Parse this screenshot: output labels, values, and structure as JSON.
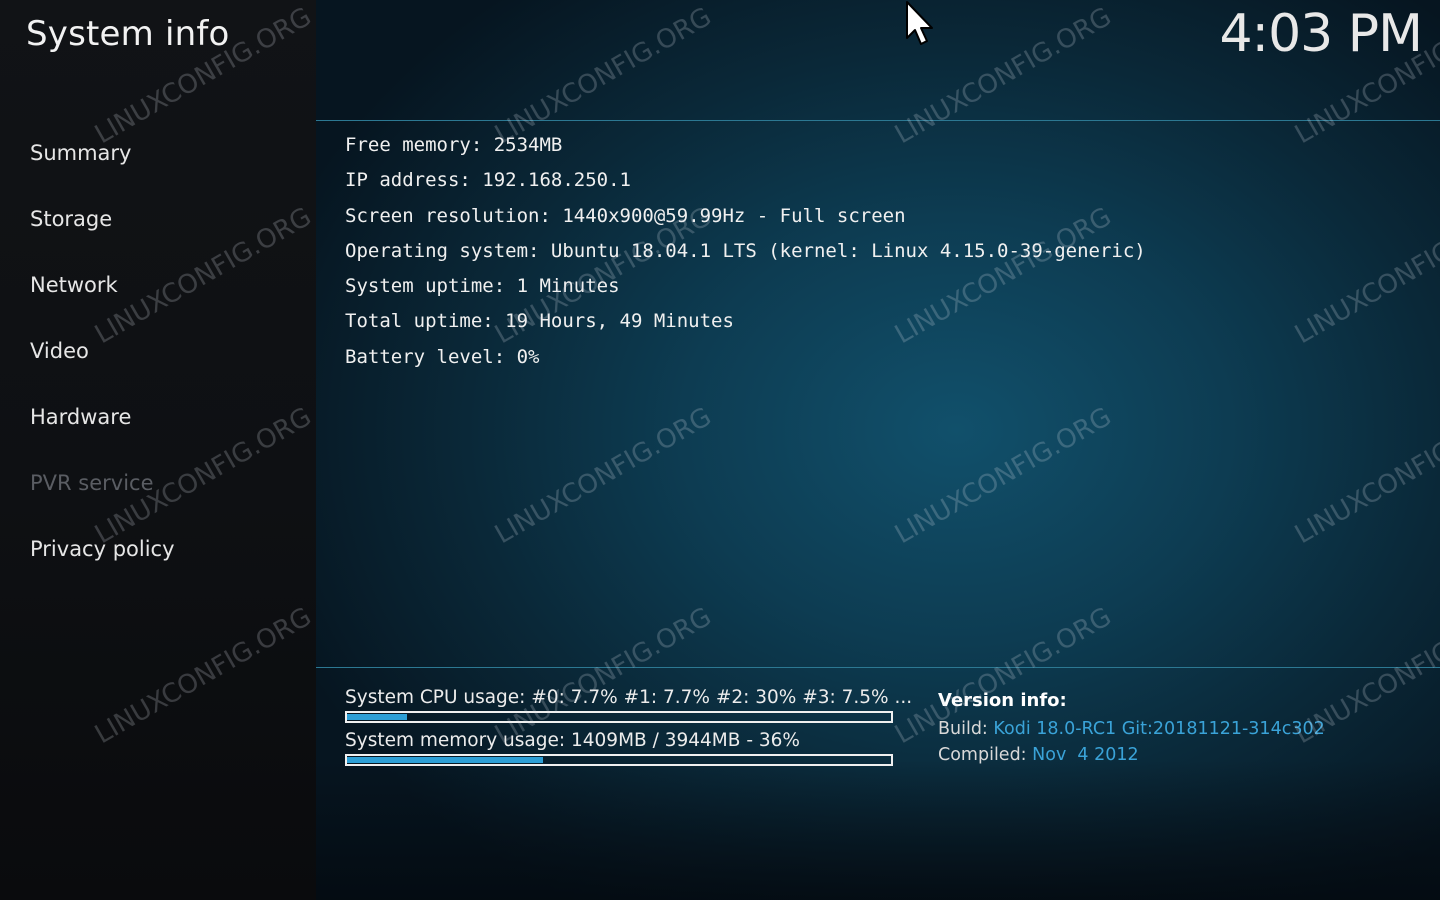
{
  "app": {
    "title": "System info",
    "clock": "4:03 PM"
  },
  "sidebar": {
    "items": [
      {
        "label": "Summary",
        "enabled": true
      },
      {
        "label": "Storage",
        "enabled": true
      },
      {
        "label": "Network",
        "enabled": true
      },
      {
        "label": "Video",
        "enabled": true
      },
      {
        "label": "Hardware",
        "enabled": true
      },
      {
        "label": "PVR service",
        "enabled": false
      },
      {
        "label": "Privacy policy",
        "enabled": true
      }
    ]
  },
  "summary": {
    "lines": [
      "Free memory: 2534MB",
      "IP address: 192.168.250.1",
      "Screen resolution: 1440x900@59.99Hz - Full screen",
      "Operating system: Ubuntu 18.04.1 LTS (kernel: Linux 4.15.0-39-generic)",
      "System uptime: 1 Minutes",
      "Total uptime: 19 Hours, 49 Minutes",
      "Battery level: 0%"
    ]
  },
  "usage": {
    "cpu": {
      "label": "System CPU usage: #0: 7.7% #1: 7.7% #2:  30% #3: 7.5% ...",
      "fraction": 0.11
    },
    "memory": {
      "label": "System memory usage: 1409MB / 3944MB - 36%",
      "fraction": 0.36
    }
  },
  "version": {
    "heading": "Version info:",
    "build_key": "Build:",
    "build_value": "Kodi 18.0-RC1 Git:20181121-314c302",
    "compiled_key": "Compiled:",
    "compiled_value": "Nov  4 2012"
  },
  "watermark": {
    "text": "LINUXCONFIG.ORG"
  },
  "colors": {
    "accent": "#2d9fd6",
    "divider": "#2c7892",
    "sidebar_bg": "#111316",
    "disabled_text": "#5a5d63"
  },
  "icons": {
    "pointer": "mouse-pointer-icon"
  }
}
